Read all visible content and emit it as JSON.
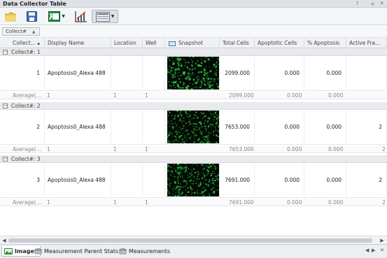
{
  "window": {
    "title": "Data Collector Table"
  },
  "groupby": {
    "chip": "Collect#"
  },
  "columns": [
    "Collect... ▴",
    "Display Name",
    "Location",
    "Well",
    "Snapshot",
    "Total Cells",
    "Apoptotic Cells",
    "% Apoptosis",
    "Active Fra..."
  ],
  "groups": [
    {
      "label": "Collect#: 1",
      "row": {
        "collect": "1",
        "name": "Apoptosis0_Alexa 488",
        "total": "2099.000",
        "apoptotic": "0.000",
        "pct": "0.000",
        "active": ""
      },
      "avg": {
        "label": "Average(...",
        "collect": "1",
        "location": "1",
        "well": "1",
        "total": "2099.000",
        "apoptotic": "0.000",
        "pct": "0.000",
        "active": ""
      }
    },
    {
      "label": "Collect#: 2",
      "row": {
        "collect": "2",
        "name": "Apoptosis0_Alexa 488",
        "total": "7653.000",
        "apoptotic": "0.000",
        "pct": "0.000",
        "active": "2"
      },
      "avg": {
        "label": "Average(...",
        "collect": "1",
        "location": "1",
        "well": "1",
        "total": "7653.000",
        "apoptotic": "0.000",
        "pct": "0.000",
        "active": "2"
      }
    },
    {
      "label": "Collect#: 3",
      "row": {
        "collect": "3",
        "name": "Apoptosis0_Alexa 488",
        "total": "7691.000",
        "apoptotic": "0.000",
        "pct": "0.000",
        "active": "2"
      },
      "avg": {
        "label": "Average(...",
        "collect": "1",
        "location": "1",
        "well": "1",
        "total": "7691.000",
        "apoptotic": "0.000",
        "pct": "0.000",
        "active": "2"
      }
    }
  ],
  "tabs": [
    {
      "label": "Image",
      "icon": "image-tab-icon"
    },
    {
      "label": "Measurement Parent Stats",
      "icon": "parent-stats-tab-icon"
    },
    {
      "label": "Measurements",
      "icon": "measurements-tab-icon"
    }
  ],
  "colors": {
    "accent": "#4a78c2",
    "cellGreen": "#27c43f"
  }
}
